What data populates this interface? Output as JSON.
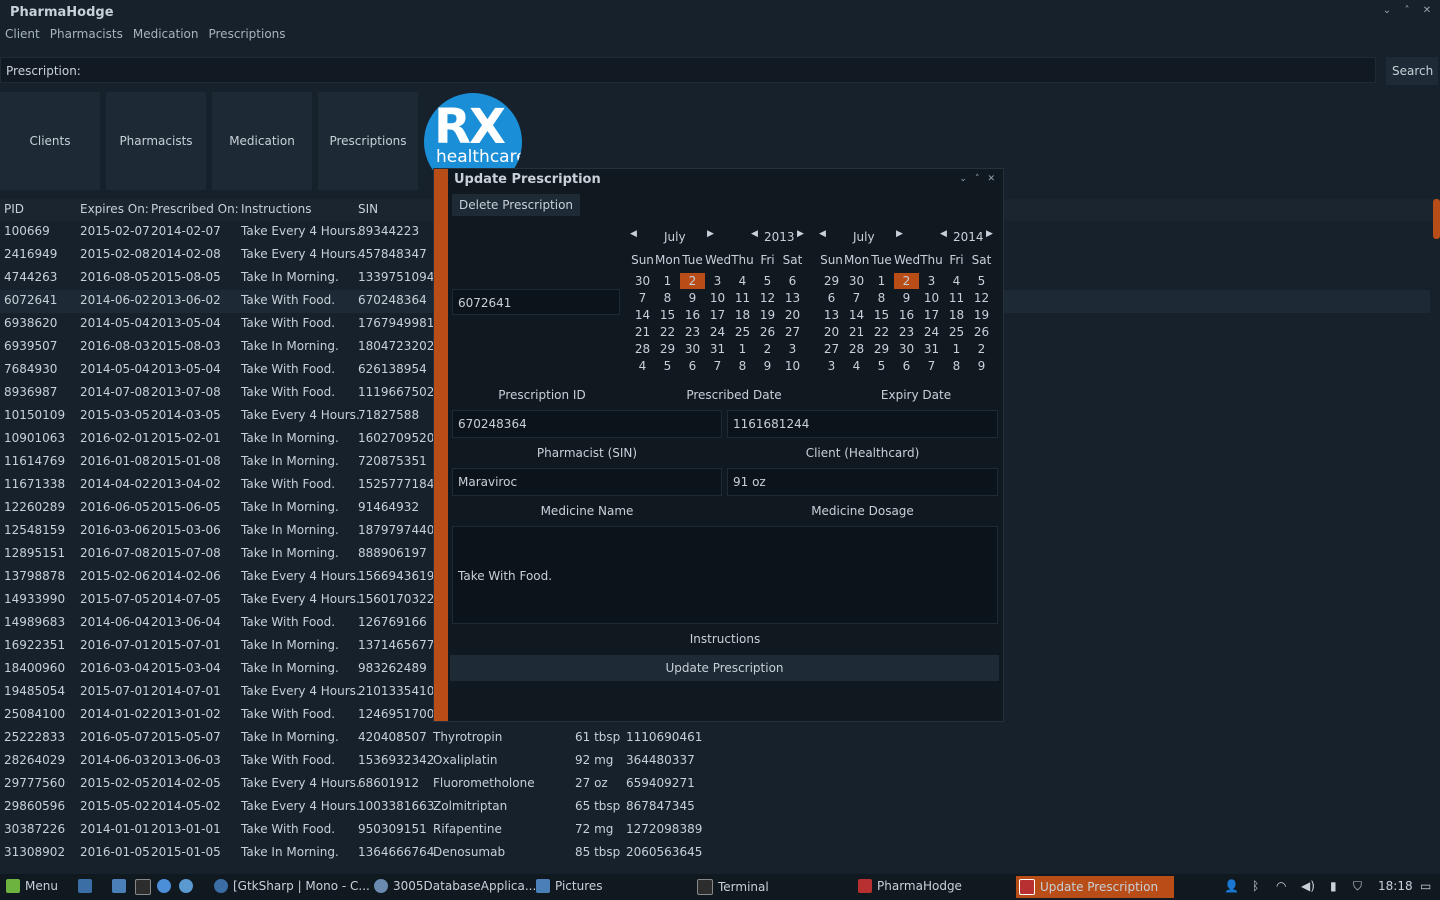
{
  "app": {
    "title": "PharmaHodge"
  },
  "window_controls": [
    "⌄",
    "˄",
    "✕"
  ],
  "menu": [
    "Client",
    "Pharmacists",
    "Medication",
    "Prescriptions"
  ],
  "search": {
    "label": "Prescription:",
    "button": "Search"
  },
  "nav_tiles": [
    "Clients",
    "Pharmacists",
    "Medication",
    "Prescriptions"
  ],
  "logo": {
    "main": "RX",
    "sub": "healthcare"
  },
  "table": {
    "headers": [
      "PID",
      "Expires On:",
      "Prescribed On:",
      "Instructions",
      "SIN"
    ],
    "rows": [
      [
        "100669",
        "2015-02-07",
        "2014-02-07",
        "Take Every 4 Hours.",
        "89344223",
        "",
        ""
      ],
      [
        "2416949",
        "2015-02-08",
        "2014-02-08",
        "Take Every 4 Hours.",
        "457848347",
        "",
        ""
      ],
      [
        "4744263",
        "2016-08-05",
        "2015-08-05",
        "Take In Morning.",
        "1339751094",
        "",
        ""
      ],
      [
        "6072641",
        "2014-06-02",
        "2013-06-02",
        "Take With Food.",
        "670248364",
        "",
        ""
      ],
      [
        "6938620",
        "2014-05-04",
        "2013-05-04",
        "Take With Food.",
        "1767949981",
        "",
        ""
      ],
      [
        "6939507",
        "2016-08-03",
        "2015-08-03",
        "Take In Morning.",
        "1804723202",
        "",
        ""
      ],
      [
        "7684930",
        "2014-05-04",
        "2013-05-04",
        "Take With Food.",
        "626138954",
        "",
        ""
      ],
      [
        "8936987",
        "2014-07-08",
        "2013-07-08",
        "Take With Food.",
        "1119667502",
        "",
        ""
      ],
      [
        "10150109",
        "2015-03-05",
        "2014-03-05",
        "Take Every 4 Hours.",
        "71827588",
        "",
        ""
      ],
      [
        "10901063",
        "2016-02-01",
        "2015-02-01",
        "Take In Morning.",
        "1602709520",
        "",
        ""
      ],
      [
        "11614769",
        "2016-01-08",
        "2015-01-08",
        "Take In Morning.",
        "720875351",
        "",
        ""
      ],
      [
        "11671338",
        "2014-04-02",
        "2013-04-02",
        "Take With Food.",
        "1525777184",
        "",
        ""
      ],
      [
        "12260289",
        "2016-06-05",
        "2015-06-05",
        "Take In Morning.",
        "91464932",
        "",
        ""
      ],
      [
        "12548159",
        "2016-03-06",
        "2015-03-06",
        "Take In Morning.",
        "1879797440",
        "",
        ""
      ],
      [
        "12895151",
        "2016-07-08",
        "2015-07-08",
        "Take In Morning.",
        "888906197",
        "",
        ""
      ],
      [
        "13798878",
        "2015-02-06",
        "2014-02-06",
        "Take Every 4 Hours.",
        "1566943619",
        "",
        ""
      ],
      [
        "14933990",
        "2015-07-05",
        "2014-07-05",
        "Take Every 4 Hours.",
        "1560170322",
        "",
        ""
      ],
      [
        "14989683",
        "2014-06-04",
        "2013-06-04",
        "Take With Food.",
        "126769166",
        "",
        ""
      ],
      [
        "16922351",
        "2016-07-01",
        "2015-07-01",
        "Take In Morning.",
        "1371465677",
        "",
        ""
      ],
      [
        "18400960",
        "2016-03-04",
        "2015-03-04",
        "Take In Morning.",
        "983262489",
        "",
        ""
      ],
      [
        "19485054",
        "2015-07-01",
        "2014-07-01",
        "Take Every 4 Hours.",
        "2101335410",
        "",
        ""
      ],
      [
        "25084100",
        "2014-01-02",
        "2013-01-02",
        "Take With Food.",
        "1246951700",
        "",
        ""
      ],
      [
        "25222833",
        "2016-05-07",
        "2015-05-07",
        "Take In Morning.",
        "420408507",
        "Thyrotropin",
        "61 tbsp",
        "1110690461"
      ],
      [
        "28264029",
        "2014-06-03",
        "2013-06-03",
        "Take With Food.",
        "1536932342",
        "Oxaliplatin",
        "92 mg",
        "364480337"
      ],
      [
        "29777560",
        "2015-02-05",
        "2014-02-05",
        "Take Every 4 Hours.",
        "68601912",
        "Fluorometholone",
        "27 oz",
        "659409271"
      ],
      [
        "29860596",
        "2015-05-02",
        "2014-05-02",
        "Take Every 4 Hours.",
        "1003381663",
        "Zolmitriptan",
        "65 tbsp",
        "867847345"
      ],
      [
        "30387226",
        "2014-01-01",
        "2013-01-01",
        "Take With Food.",
        "950309151",
        "Rifapentine",
        "72 mg",
        "1272098389"
      ],
      [
        "31308902",
        "2016-01-05",
        "2015-01-05",
        "Take In Morning.",
        "1364666764",
        "Denosumab",
        "85 tbsp",
        "2060563645"
      ]
    ]
  },
  "dialog": {
    "title": "Update Prescription",
    "controls": [
      "⌄",
      "˄",
      "✕"
    ],
    "delete_button": "Delete Prescription",
    "pid_value": "6072641",
    "labels": {
      "prescription_id": "Prescription ID",
      "prescribed_date": "Prescribed Date",
      "expiry_date": "Expiry Date",
      "pharmacist": "Pharmacist (SIN)",
      "client": "Client (Healthcard)",
      "medicine_name": "Medicine Name",
      "medicine_dosage": "Medicine Dosage",
      "instructions": "Instructions"
    },
    "values": {
      "pharmacist": "670248364",
      "client": "1161681244",
      "medicine_name": "Maraviroc",
      "medicine_dosage": "91 oz",
      "instructions": "Take With Food."
    },
    "update_button": "Update Prescription",
    "calendars": [
      {
        "month": "July",
        "year": "2013",
        "selected": "2",
        "day_names": [
          "Sun",
          "Mon",
          "Tue",
          "Wed",
          "Thu",
          "Fri",
          "Sat"
        ],
        "weeks": [
          [
            "30",
            "1",
            "2",
            "3",
            "4",
            "5",
            "6"
          ],
          [
            "7",
            "8",
            "9",
            "10",
            "11",
            "12",
            "13"
          ],
          [
            "14",
            "15",
            "16",
            "17",
            "18",
            "19",
            "20"
          ],
          [
            "21",
            "22",
            "23",
            "24",
            "25",
            "26",
            "27"
          ],
          [
            "28",
            "29",
            "30",
            "31",
            "1",
            "2",
            "3"
          ],
          [
            "4",
            "5",
            "6",
            "7",
            "8",
            "9",
            "10"
          ]
        ]
      },
      {
        "month": "July",
        "year": "2014",
        "selected": "2",
        "day_names": [
          "Sun",
          "Mon",
          "Tue",
          "Wed",
          "Thu",
          "Fri",
          "Sat"
        ],
        "weeks": [
          [
            "29",
            "30",
            "1",
            "2",
            "3",
            "4",
            "5"
          ],
          [
            "6",
            "7",
            "8",
            "9",
            "10",
            "11",
            "12"
          ],
          [
            "13",
            "14",
            "15",
            "16",
            "17",
            "18",
            "19"
          ],
          [
            "20",
            "21",
            "22",
            "23",
            "24",
            "25",
            "26"
          ],
          [
            "27",
            "28",
            "29",
            "30",
            "31",
            "1",
            "2"
          ],
          [
            "3",
            "4",
            "5",
            "6",
            "7",
            "8",
            "9"
          ]
        ]
      }
    ]
  },
  "taskbar": {
    "menu": "Menu",
    "items": [
      "[GtkSharp | Mono - C...",
      "3005DatabaseApplica...",
      "Pictures",
      "Terminal",
      "PharmaHodge",
      "Update Prescription"
    ],
    "clock": "18:18"
  }
}
